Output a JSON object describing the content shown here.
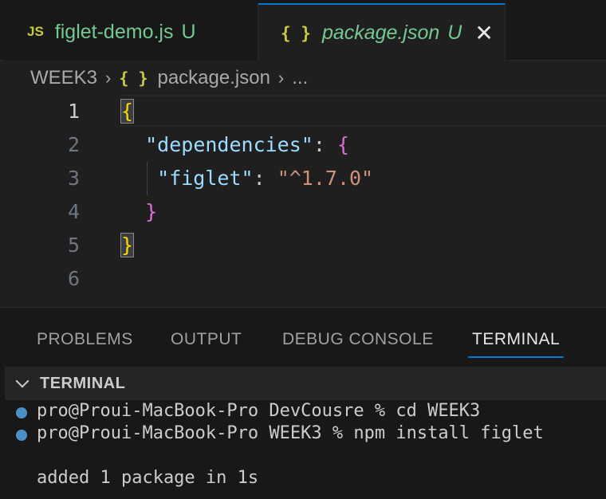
{
  "tabs": [
    {
      "icon": "JS",
      "title": "figlet-demo.js",
      "status": "U",
      "active": false
    },
    {
      "icon": "{ }",
      "title": "package.json",
      "status": "U",
      "active": true,
      "close": "✕"
    }
  ],
  "breadcrumb": {
    "folder": "WEEK3",
    "file_icon": "{ }",
    "file": "package.json",
    "more": "..."
  },
  "editor": {
    "line_numbers": [
      "1",
      "2",
      "3",
      "4",
      "5",
      "6"
    ],
    "lines": {
      "l1": {
        "brace": "{"
      },
      "l2": {
        "key": "\"dependencies\"",
        "colon": ":",
        "brace": "{"
      },
      "l3": {
        "key": "\"figlet\"",
        "colon": ":",
        "value": "\"^1.7.0\""
      },
      "l4": {
        "brace": "}"
      },
      "l5": {
        "brace": "}"
      }
    }
  },
  "panel": {
    "tabs": [
      "PROBLEMS",
      "OUTPUT",
      "DEBUG CONSOLE",
      "TERMINAL"
    ],
    "active_tab": "TERMINAL",
    "section_title": "TERMINAL",
    "terminal_lines": [
      "pro@Proui-MacBook-Pro DevCousre % cd WEEK3",
      "pro@Proui-MacBook-Pro WEEK3 % npm install figlet",
      "added 1 package in 1s"
    ]
  },
  "colors": {
    "tab_accent": "#0078d4",
    "untracked_green": "#73c991",
    "json_key": "#9cdcfe",
    "json_string": "#ce9178",
    "bracket_gold": "#ffd700",
    "bracket_purple": "#da70d6"
  }
}
